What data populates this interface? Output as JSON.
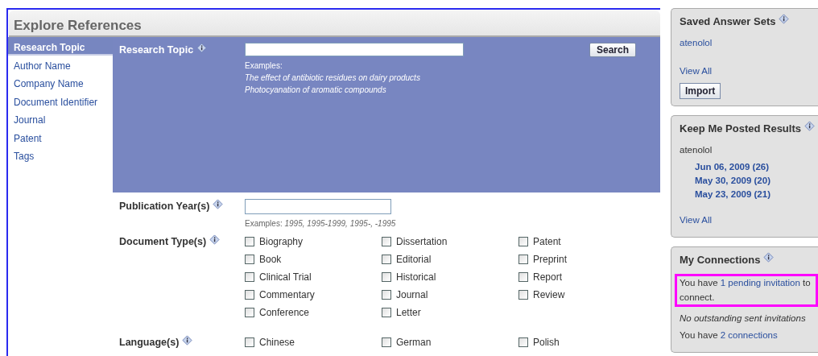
{
  "main": {
    "title": "Explore References",
    "sidebar": {
      "items": [
        {
          "label": "Research Topic",
          "selected": true
        },
        {
          "label": "Author Name",
          "selected": false
        },
        {
          "label": "Company Name",
          "selected": false
        },
        {
          "label": "Document Identifier",
          "selected": false
        },
        {
          "label": "Journal",
          "selected": false
        },
        {
          "label": "Patent",
          "selected": false
        },
        {
          "label": "Tags",
          "selected": false
        }
      ]
    },
    "search": {
      "label": "Research Topic",
      "button": "Search",
      "examples_label": "Examples:",
      "examples": [
        "The effect of antibiotic residues on dairy products",
        "Photocyanation of aromatic compounds"
      ]
    },
    "publication_year": {
      "label": "Publication Year(s)",
      "examples_label": "Examples:",
      "examples": "1995, 1995-1999, 1995-, -1995"
    },
    "groups": [
      {
        "label": "Document Type(s)",
        "options": [
          {
            "label": "Biography",
            "checked": false
          },
          {
            "label": "Book",
            "checked": false
          },
          {
            "label": "Clinical Trial",
            "checked": false
          },
          {
            "label": "Commentary",
            "checked": false
          },
          {
            "label": "Conference",
            "checked": false
          },
          {
            "label": "Dissertation",
            "checked": false
          },
          {
            "label": "Editorial",
            "checked": false
          },
          {
            "label": "Historical",
            "checked": false
          },
          {
            "label": "Journal",
            "checked": false
          },
          {
            "label": "Letter",
            "checked": false
          },
          {
            "label": "Patent",
            "checked": false
          },
          {
            "label": "Preprint",
            "checked": false
          },
          {
            "label": "Report",
            "checked": false
          },
          {
            "label": "Review",
            "checked": false
          }
        ]
      },
      {
        "label": "Language(s)",
        "options": [
          {
            "label": "Chinese",
            "checked": false
          },
          {
            "label": "German",
            "checked": false
          },
          {
            "label": "Polish",
            "checked": false
          }
        ]
      }
    ]
  },
  "panels": [
    {
      "title": "Saved Answer Sets",
      "lines": [
        {
          "kind": "link",
          "text": "atenolol"
        },
        {
          "kind": "gap"
        },
        {
          "kind": "link",
          "text": "View All"
        },
        {
          "kind": "button",
          "text": "Import"
        }
      ]
    },
    {
      "title": "Keep Me Posted Results",
      "lines": [
        {
          "kind": "text",
          "text": "atenolol"
        },
        {
          "kind": "date",
          "text": "Jun 06, 2009 (26)"
        },
        {
          "kind": "date",
          "text": "May 30, 2009 (20)"
        },
        {
          "kind": "date",
          "text": "May 23, 2009 (21)"
        },
        {
          "kind": "gap"
        },
        {
          "kind": "link",
          "text": "View All"
        }
      ]
    },
    {
      "title": "My Connections",
      "lines": [
        {
          "kind": "sentence",
          "before": "You have ",
          "link": "1 pending invitation",
          "after": " to connect.",
          "highlighted": true
        },
        {
          "kind": "note",
          "text": "No outstanding sent invitations"
        },
        {
          "kind": "sentence",
          "before": "You have ",
          "link": "2 connections",
          "highlighted": false
        }
      ]
    }
  ]
}
